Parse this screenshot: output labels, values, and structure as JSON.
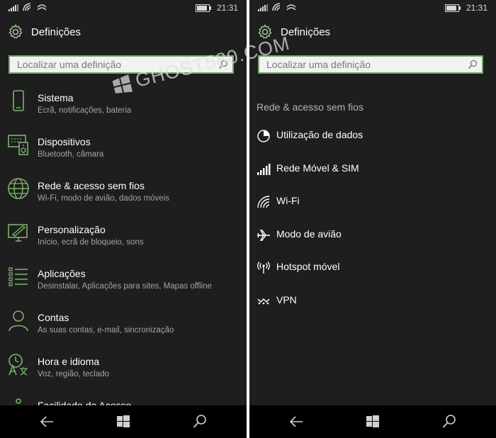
{
  "status": {
    "time": "21:31"
  },
  "left": {
    "header_title": "Definições",
    "search_placeholder": "Localizar uma definição",
    "items": [
      {
        "title": "Sistema",
        "subtitle": "Ecrã, notificações, bateria",
        "icon": "phone-icon"
      },
      {
        "title": "Dispositivos",
        "subtitle": "Bluetooth, câmara",
        "icon": "devices-icon"
      },
      {
        "title": "Rede & acesso sem fios",
        "subtitle": "Wi-Fi, modo de avião, dados móveis",
        "icon": "globe-icon"
      },
      {
        "title": "Personalização",
        "subtitle": "Início, ecrã de bloqueio, sons",
        "icon": "personalization-icon"
      },
      {
        "title": "Aplicações",
        "subtitle": "Desinstalar, Aplicações para sites, Mapas offline",
        "icon": "apps-list-icon"
      },
      {
        "title": "Contas",
        "subtitle": "As suas contas, e-mail, sincronização",
        "icon": "person-icon"
      },
      {
        "title": "Hora e idioma",
        "subtitle": "Voz, região, teclado",
        "icon": "time-language-icon"
      },
      {
        "title": "Facilidade de Acesso",
        "subtitle": "",
        "icon": "ease-of-access-icon"
      }
    ]
  },
  "right": {
    "header_title": "Definições",
    "search_placeholder": "Localizar uma definição",
    "section_title": "Rede & acesso sem fios",
    "items": [
      {
        "title": "Utilização de dados",
        "icon": "data-usage-icon"
      },
      {
        "title": "Rede Móvel & SIM",
        "icon": "cellular-icon"
      },
      {
        "title": "Wi-Fi",
        "icon": "wifi-icon"
      },
      {
        "title": "Modo de avião",
        "icon": "airplane-icon"
      },
      {
        "title": "Hotspot móvel",
        "icon": "hotspot-icon"
      },
      {
        "title": "VPN",
        "icon": "vpn-icon"
      }
    ]
  },
  "watermark": {
    "text": "GHOST580.COM"
  },
  "colors": {
    "accent": "#7cb26f",
    "background": "#1e1e1e",
    "navbar": "#000000",
    "subtitle": "#a4a4a4"
  }
}
